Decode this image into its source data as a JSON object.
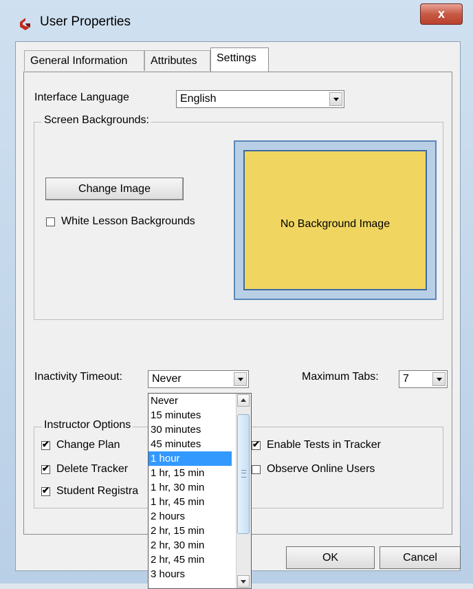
{
  "window": {
    "title": "User Properties",
    "close_glyph": "x",
    "app_icon": "app-logo-icon",
    "close_color": "#c75a45"
  },
  "tabs": [
    {
      "label": "General Information"
    },
    {
      "label": "Attributes"
    },
    {
      "label": "Settings",
      "selected": true
    }
  ],
  "settings": {
    "interface_language_label": "Interface Language",
    "interface_language_value": "English",
    "screen_backgrounds_title": "Screen Backgrounds:",
    "change_image_button": "Change Image",
    "white_lesson_backgrounds_label": "White Lesson Backgrounds",
    "white_lesson_backgrounds_checked": false,
    "preview_text": "No Background Image",
    "preview_color": "#f0d661",
    "inactivity_timeout_label": "Inactivity Timeout:",
    "inactivity_timeout_value": "Never",
    "maximum_tabs_label": "Maximum Tabs:",
    "maximum_tabs_value": "7",
    "instructor_options_title": "Instructor Options",
    "instructor_options": [
      {
        "label": "Change Plan",
        "checked": true
      },
      {
        "label": "Delete Tracker",
        "checked": true
      },
      {
        "label": "Student Registra",
        "checked": true
      },
      {
        "label": "Enable Tests in Tracker",
        "checked": true
      },
      {
        "label": "Observe Online Users",
        "checked": false
      }
    ]
  },
  "inactivity_dropdown": {
    "items": [
      "Never",
      "15 minutes",
      "30 minutes",
      "45 minutes",
      "1 hour",
      "1 hr, 15 min",
      "1 hr, 30 min",
      "1 hr, 45 min",
      "2 hours",
      "2 hr, 15 min",
      "2 hr, 30 min",
      "2 hr, 45 min",
      "3 hours"
    ],
    "highlighted": "1 hour",
    "highlight_color": "#3399ff"
  },
  "footer": {
    "ok_label": "OK",
    "cancel_label": "Cancel"
  }
}
